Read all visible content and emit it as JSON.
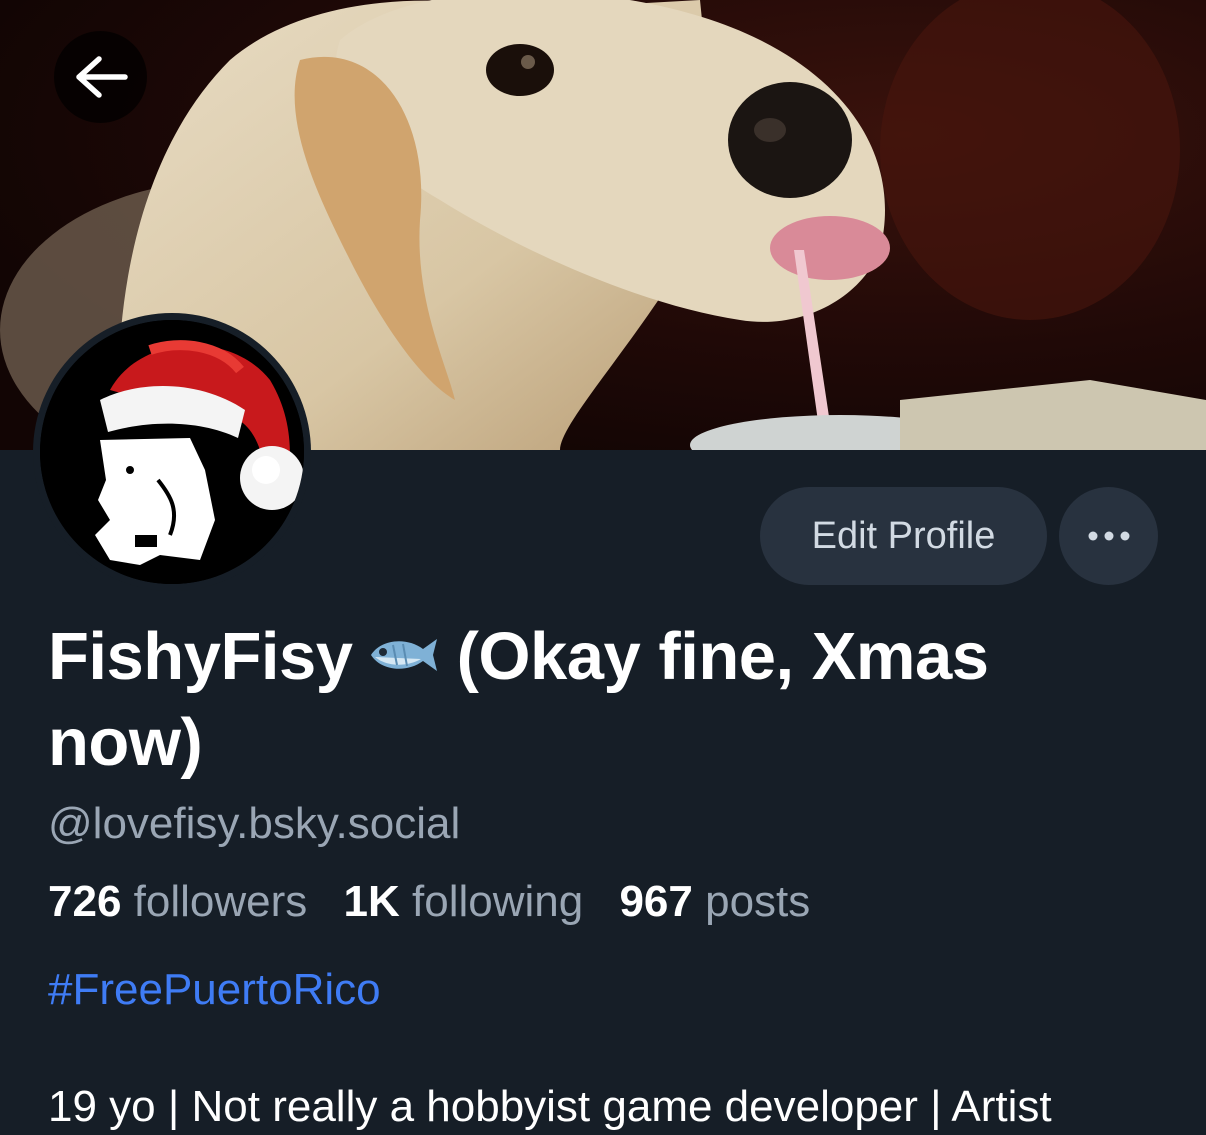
{
  "profile": {
    "display_name_part1": "FishyFisy",
    "display_name_part2": "(Okay fine, Xmas now)",
    "name_emoji": "fish-emoji",
    "handle": "@lovefisy.bsky.social",
    "hashtag": "#FreePuertoRico",
    "bio_first_line": "19 yo | Not really a hobbyist game developer | Artist"
  },
  "stats": {
    "followers_count": "726",
    "followers_label": "followers",
    "following_count": "1K",
    "following_label": "following",
    "posts_count": "967",
    "posts_label": "posts"
  },
  "actions": {
    "edit_profile_label": "Edit Profile",
    "more_icon": "ellipsis-icon",
    "back_icon": "arrow-left-icon"
  },
  "colors": {
    "background": "#161e27",
    "button_bg": "#28323f",
    "secondary_text": "#9aa6b4",
    "link": "#3f7cf5"
  }
}
